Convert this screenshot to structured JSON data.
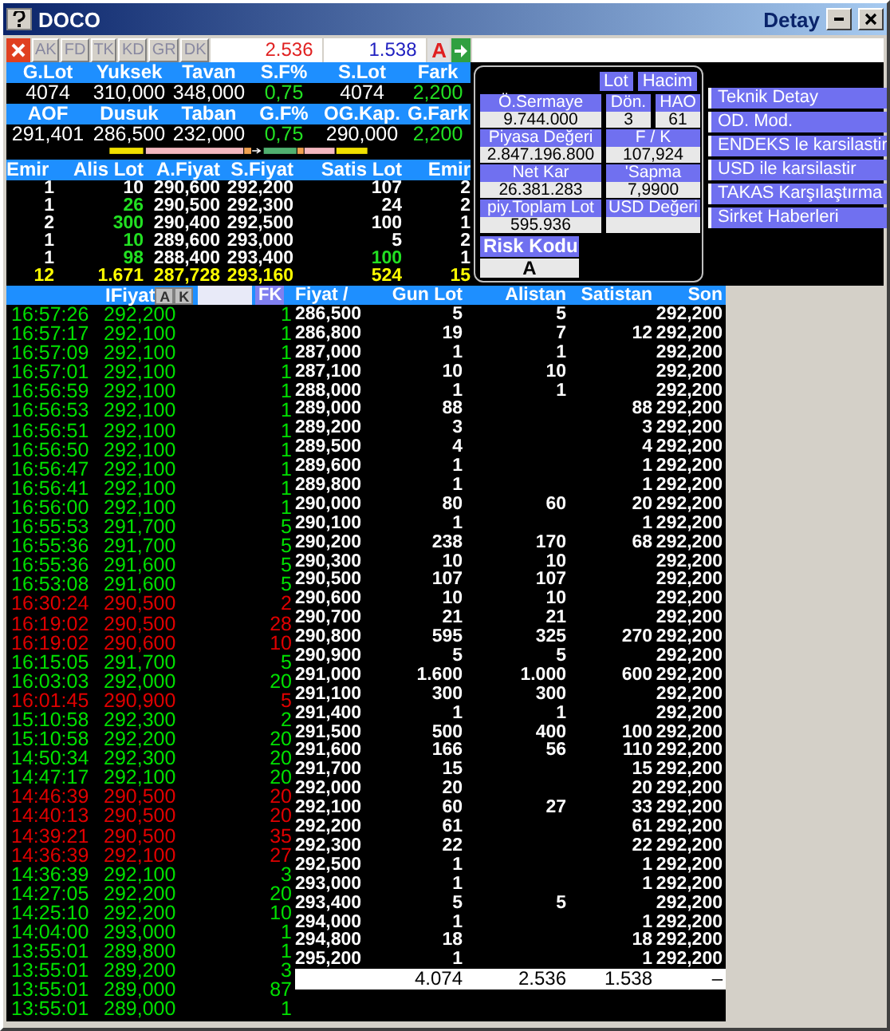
{
  "window": {
    "title": "DOCO",
    "subtitle": "Detay"
  },
  "toolbar": {
    "buttons": [
      "AK",
      "FD",
      "TK",
      "KD",
      "GR",
      "DK"
    ],
    "bid_total": "2.536",
    "ask_total": "1.538",
    "mode": "A"
  },
  "stat_groups": [
    {
      "cells": [
        {
          "label": "G.Lot",
          "value": "4074",
          "up": false
        },
        {
          "label": "Yuksek",
          "value": "310,000",
          "up": false
        },
        {
          "label": "Tavan",
          "value": "348,000",
          "up": false
        },
        {
          "label": "S.F%",
          "value": "0,75",
          "up": true
        },
        {
          "label": "S.Lot",
          "value": "4074",
          "up": false
        },
        {
          "label": "Fark",
          "value": "2,200",
          "up": true
        }
      ]
    },
    {
      "cells": [
        {
          "label": "AOF",
          "value": "291,401",
          "up": false
        },
        {
          "label": "Dusuk",
          "value": "286,500",
          "up": false
        },
        {
          "label": "Taban",
          "value": "232,000",
          "up": false
        },
        {
          "label": "G.F%",
          "value": "0,75",
          "up": true
        },
        {
          "label": "OG.Kap.",
          "value": "290,000",
          "up": false
        },
        {
          "label": "G.Fark",
          "value": "2,200",
          "up": true
        }
      ]
    }
  ],
  "order_book": {
    "columns": [
      "Emir",
      "Alis Lot",
      "A.Fiyat",
      "S.Fiyat",
      "Satis Lot",
      "Emir"
    ],
    "rows": [
      {
        "bid_orders": "1",
        "bid_lot": "10",
        "bid_up": false,
        "bid_price": "290,600",
        "ask_price": "292,200",
        "ask_lot": "107",
        "ask_up": false,
        "ask_orders": "2"
      },
      {
        "bid_orders": "1",
        "bid_lot": "26",
        "bid_up": true,
        "bid_price": "290,500",
        "ask_price": "292,300",
        "ask_lot": "24",
        "ask_up": false,
        "ask_orders": "2"
      },
      {
        "bid_orders": "2",
        "bid_lot": "300",
        "bid_up": true,
        "bid_price": "290,400",
        "ask_price": "292,500",
        "ask_lot": "100",
        "ask_up": false,
        "ask_orders": "1"
      },
      {
        "bid_orders": "1",
        "bid_lot": "10",
        "bid_up": true,
        "bid_price": "289,600",
        "ask_price": "293,000",
        "ask_lot": "5",
        "ask_up": false,
        "ask_orders": "2"
      },
      {
        "bid_orders": "1",
        "bid_lot": "98",
        "bid_up": true,
        "bid_price": "288,400",
        "ask_price": "293,400",
        "ask_lot": "100",
        "ask_up": true,
        "ask_orders": "1"
      }
    ],
    "total": {
      "bid_orders": "12",
      "bid_lot": "1.671",
      "bid_price": "287,728",
      "ask_price": "293,160",
      "ask_lot": "524",
      "ask_orders": "15"
    }
  },
  "info_panel": {
    "toggles": [
      "Lot",
      "Hacim"
    ],
    "fields": [
      {
        "label": "Ö.Sermaye",
        "value": "9.744.000",
        "kind": "wide"
      },
      {
        "label": "Dön.",
        "value": "3",
        "kind": "narrow"
      },
      {
        "label": "HAO",
        "value": "61",
        "kind": "narrow"
      },
      {
        "label": "Piyasa Değeri",
        "value": "2.847.196.800",
        "kind": "wide"
      },
      {
        "label": "F / K",
        "value": "107,924",
        "kind": "pair"
      },
      {
        "label": "Net Kar",
        "value": "26.381.283",
        "kind": "wide"
      },
      {
        "label": "'Sapma",
        "value": "7,9900",
        "kind": "pair"
      },
      {
        "label": "piy.Toplam Lot",
        "value": "595.936",
        "kind": "wide"
      },
      {
        "label": "USD Değeri",
        "kind": "pair"
      }
    ],
    "risk": {
      "label": "Risk Kodu",
      "value": "A"
    }
  },
  "actions": [
    "Teknik Detay",
    "OD. Mod.",
    "ENDEKS le karsilastir",
    "USD ile karsilastir",
    "TAKAS Karşılaştırma",
    "Sirket Haberleri"
  ],
  "trades": {
    "label": "IFiyat",
    "buttons": [
      "A",
      "K"
    ],
    "filter_button": "FK",
    "rows": [
      {
        "time": "16:57:26",
        "price": "292,200",
        "lot": "1",
        "color": "#00e000"
      },
      {
        "time": "16:57:17",
        "price": "292,100",
        "lot": "1",
        "color": "#00e000"
      },
      {
        "time": "16:57:09",
        "price": "292,100",
        "lot": "1",
        "color": "#00e000"
      },
      {
        "time": "16:57:01",
        "price": "292,100",
        "lot": "1",
        "color": "#00e000"
      },
      {
        "time": "16:56:59",
        "price": "292,100",
        "lot": "1",
        "color": "#00e000"
      },
      {
        "time": "16:56:53",
        "price": "292,100",
        "lot": "1",
        "color": "#00e000"
      },
      {
        "time": "16:56:51",
        "price": "292,100",
        "lot": "1",
        "color": "#00e000"
      },
      {
        "time": "16:56:50",
        "price": "292,100",
        "lot": "1",
        "color": "#00e000"
      },
      {
        "time": "16:56:47",
        "price": "292,100",
        "lot": "1",
        "color": "#00e000"
      },
      {
        "time": "16:56:41",
        "price": "292,100",
        "lot": "1",
        "color": "#00e000"
      },
      {
        "time": "16:56:00",
        "price": "292,100",
        "lot": "1",
        "color": "#00e000"
      },
      {
        "time": "16:55:53",
        "price": "291,700",
        "lot": "5",
        "color": "#00e000"
      },
      {
        "time": "16:55:36",
        "price": "291,700",
        "lot": "5",
        "color": "#00e000"
      },
      {
        "time": "16:55:36",
        "price": "291,600",
        "lot": "5",
        "color": "#00e000"
      },
      {
        "time": "16:53:08",
        "price": "291,600",
        "lot": "5",
        "color": "#00e000"
      },
      {
        "time": "16:30:24",
        "price": "290,500",
        "lot": "2",
        "color": "#e00000"
      },
      {
        "time": "16:19:02",
        "price": "290,500",
        "lot": "28",
        "color": "#e00000"
      },
      {
        "time": "16:19:02",
        "price": "290,600",
        "lot": "10",
        "color": "#e00000"
      },
      {
        "time": "16:15:05",
        "price": "291,700",
        "lot": "5",
        "color": "#00e000"
      },
      {
        "time": "16:03:03",
        "price": "292,000",
        "lot": "20",
        "color": "#00e000"
      },
      {
        "time": "16:01:45",
        "price": "290,900",
        "lot": "5",
        "color": "#e00000"
      },
      {
        "time": "15:10:58",
        "price": "292,300",
        "lot": "2",
        "color": "#00e000"
      },
      {
        "time": "15:10:58",
        "price": "292,200",
        "lot": "20",
        "color": "#00e000"
      },
      {
        "time": "14:50:34",
        "price": "292,300",
        "lot": "20",
        "color": "#00e000"
      },
      {
        "time": "14:47:17",
        "price": "292,100",
        "lot": "20",
        "color": "#00e000"
      },
      {
        "time": "14:46:39",
        "price": "290,500",
        "lot": "20",
        "color": "#e00000"
      },
      {
        "time": "14:40:13",
        "price": "290,500",
        "lot": "20",
        "color": "#e00000"
      },
      {
        "time": "14:39:21",
        "price": "290,500",
        "lot": "35",
        "color": "#e00000"
      },
      {
        "time": "14:36:39",
        "price": "292,100",
        "lot": "27",
        "color": "#e00000"
      },
      {
        "time": "14:36:39",
        "price": "292,100",
        "lot": "3",
        "color": "#00e000"
      },
      {
        "time": "14:27:05",
        "price": "292,200",
        "lot": "20",
        "color": "#00e000"
      },
      {
        "time": "14:25:10",
        "price": "292,200",
        "lot": "10",
        "color": "#00e000"
      },
      {
        "time": "14:04:00",
        "price": "293,000",
        "lot": "1",
        "color": "#00e000"
      },
      {
        "time": "13:55:01",
        "price": "289,800",
        "lot": "1",
        "color": "#00e000"
      },
      {
        "time": "13:55:01",
        "price": "289,200",
        "lot": "3",
        "color": "#00e000"
      },
      {
        "time": "13:55:01",
        "price": "289,000",
        "lot": "87",
        "color": "#00e000"
      },
      {
        "time": "13:55:01",
        "price": "289,000",
        "lot": "1",
        "color": "#00e000"
      }
    ]
  },
  "price_table": {
    "columns": [
      "Fiyat /",
      "Gun Lot",
      "Alistan",
      "Satistan",
      "Son"
    ],
    "rows": [
      {
        "price": "286,500",
        "day_lot": "5",
        "bid": "5",
        "ask": "",
        "last": "292,200"
      },
      {
        "price": "286,800",
        "day_lot": "19",
        "bid": "7",
        "ask": "12",
        "last": "292,200"
      },
      {
        "price": "287,000",
        "day_lot": "1",
        "bid": "1",
        "ask": "",
        "last": "292,200"
      },
      {
        "price": "287,100",
        "day_lot": "10",
        "bid": "10",
        "ask": "",
        "last": "292,200"
      },
      {
        "price": "288,000",
        "day_lot": "1",
        "bid": "1",
        "ask": "",
        "last": "292,200"
      },
      {
        "price": "289,000",
        "day_lot": "88",
        "bid": "",
        "ask": "88",
        "last": "292,200"
      },
      {
        "price": "289,200",
        "day_lot": "3",
        "bid": "",
        "ask": "3",
        "last": "292,200"
      },
      {
        "price": "289,500",
        "day_lot": "4",
        "bid": "",
        "ask": "4",
        "last": "292,200"
      },
      {
        "price": "289,600",
        "day_lot": "1",
        "bid": "",
        "ask": "1",
        "last": "292,200"
      },
      {
        "price": "289,800",
        "day_lot": "1",
        "bid": "",
        "ask": "1",
        "last": "292,200"
      },
      {
        "price": "290,000",
        "day_lot": "80",
        "bid": "60",
        "ask": "20",
        "last": "292,200"
      },
      {
        "price": "290,100",
        "day_lot": "1",
        "bid": "",
        "ask": "1",
        "last": "292,200"
      },
      {
        "price": "290,200",
        "day_lot": "238",
        "bid": "170",
        "ask": "68",
        "last": "292,200"
      },
      {
        "price": "290,300",
        "day_lot": "10",
        "bid": "10",
        "ask": "",
        "last": "292,200"
      },
      {
        "price": "290,500",
        "day_lot": "107",
        "bid": "107",
        "ask": "",
        "last": "292,200"
      },
      {
        "price": "290,600",
        "day_lot": "10",
        "bid": "10",
        "ask": "",
        "last": "292,200"
      },
      {
        "price": "290,700",
        "day_lot": "21",
        "bid": "21",
        "ask": "",
        "last": "292,200"
      },
      {
        "price": "290,800",
        "day_lot": "595",
        "bid": "325",
        "ask": "270",
        "last": "292,200"
      },
      {
        "price": "290,900",
        "day_lot": "5",
        "bid": "5",
        "ask": "",
        "last": "292,200"
      },
      {
        "price": "291,000",
        "day_lot": "1.600",
        "bid": "1.000",
        "ask": "600",
        "last": "292,200"
      },
      {
        "price": "291,100",
        "day_lot": "300",
        "bid": "300",
        "ask": "",
        "last": "292,200"
      },
      {
        "price": "291,400",
        "day_lot": "1",
        "bid": "1",
        "ask": "",
        "last": "292,200"
      },
      {
        "price": "291,500",
        "day_lot": "500",
        "bid": "400",
        "ask": "100",
        "last": "292,200"
      },
      {
        "price": "291,600",
        "day_lot": "166",
        "bid": "56",
        "ask": "110",
        "last": "292,200"
      },
      {
        "price": "291,700",
        "day_lot": "15",
        "bid": "",
        "ask": "15",
        "last": "292,200"
      },
      {
        "price": "292,000",
        "day_lot": "20",
        "bid": "",
        "ask": "20",
        "last": "292,200"
      },
      {
        "price": "292,100",
        "day_lot": "60",
        "bid": "27",
        "ask": "33",
        "last": "292,200"
      },
      {
        "price": "292,200",
        "day_lot": "61",
        "bid": "",
        "ask": "61",
        "last": "292,200"
      },
      {
        "price": "292,300",
        "day_lot": "22",
        "bid": "",
        "ask": "22",
        "last": "292,200"
      },
      {
        "price": "292,500",
        "day_lot": "1",
        "bid": "",
        "ask": "1",
        "last": "292,200"
      },
      {
        "price": "293,000",
        "day_lot": "1",
        "bid": "",
        "ask": "1",
        "last": "292,200"
      },
      {
        "price": "293,400",
        "day_lot": "5",
        "bid": "5",
        "ask": "",
        "last": "292,200"
      },
      {
        "price": "294,000",
        "day_lot": "1",
        "bid": "",
        "ask": "1",
        "last": "292,200"
      },
      {
        "price": "294,800",
        "day_lot": "18",
        "bid": "",
        "ask": "18",
        "last": "292,200"
      },
      {
        "price": "295,200",
        "day_lot": "1",
        "bid": "",
        "ask": "1",
        "last": "292,200"
      }
    ],
    "totals": [
      "4.074",
      "2.536",
      "1.538",
      "–"
    ]
  }
}
